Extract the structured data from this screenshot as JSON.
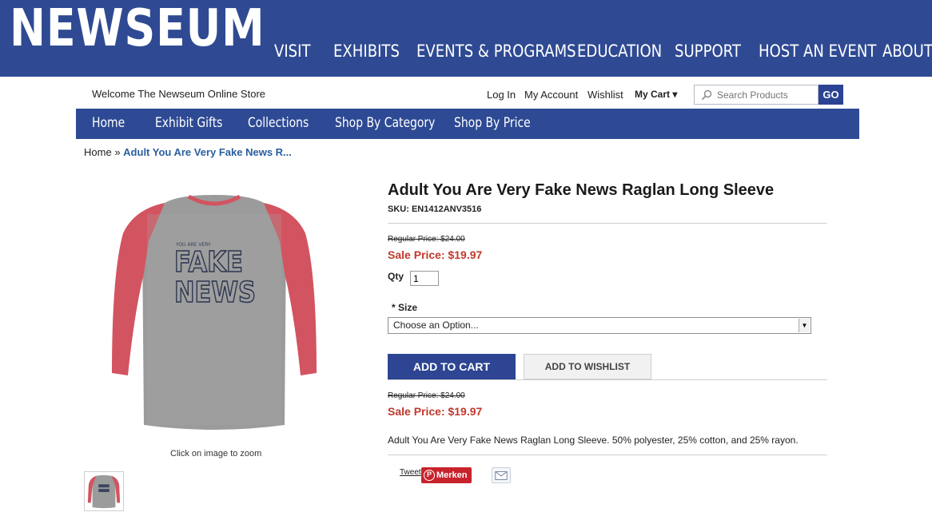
{
  "brand": {
    "logo_text": "NEWSEUM",
    "primary_color": "#2f4a93",
    "sale_color": "#c0392b"
  },
  "main_nav": [
    "VISIT",
    "EXHIBITS",
    "EVENTS & PROGRAMS",
    "EDUCATION",
    "SUPPORT",
    "HOST AN EVENT",
    "ABOUT"
  ],
  "store_header": {
    "welcome": "Welcome The Newseum Online Store",
    "links": [
      "Log In",
      "My Account",
      "Wishlist"
    ],
    "cart": "My Cart ▾",
    "search_placeholder": "Search Products",
    "search_button": "GO"
  },
  "store_nav": [
    "Home",
    "Exhibit Gifts",
    "Collections",
    "Shop By Category",
    "Shop By Price"
  ],
  "breadcrumb": {
    "home": "Home",
    "separator": "»",
    "current": "Adult You Are Very Fake News R..."
  },
  "product": {
    "title": "Adult You Are Very Fake News Raglan Long Sleeve",
    "sku": "SKU: EN1412ANV3516",
    "regular_price": "Regular Price: $24.00",
    "sale_price": "Sale Price: $19.97",
    "qty_label": "Qty",
    "qty_value": "1",
    "size_label": "* Size",
    "size_selected": "Choose an Option...",
    "add_to_cart": "ADD TO CART",
    "add_to_wishlist": "ADD TO WISHLIST",
    "description": "Adult You Are Very Fake News Raglan Long Sleeve. 50% polyester, 25% cotton, and 25% rayon.",
    "image_hint": "Click on image to zoom",
    "shirt_text_small": "YOU ARE VERY",
    "shirt_text_line1": "FAKE",
    "shirt_text_line2": "NEWS"
  },
  "share": {
    "tweet": "Tweet",
    "pin": "Merken",
    "email_icon": "mail-icon"
  }
}
